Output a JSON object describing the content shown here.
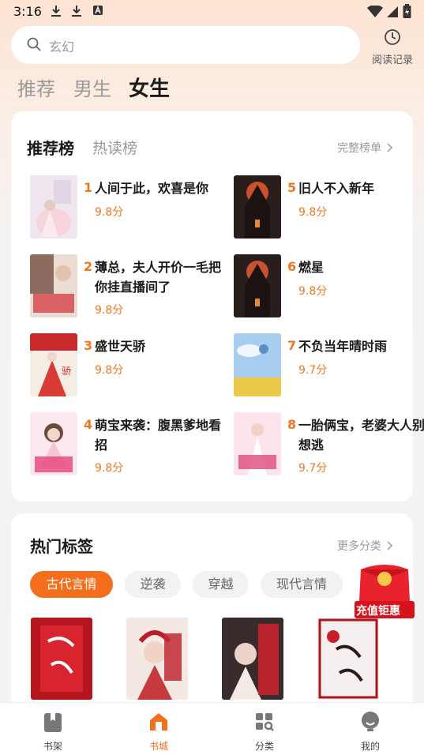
{
  "status_bar": {
    "time": "3:16"
  },
  "search": {
    "placeholder": "玄幻",
    "history_label": "阅读记录"
  },
  "top_tabs": [
    {
      "label": "推荐"
    },
    {
      "label": "男生"
    },
    {
      "label": "女生"
    }
  ],
  "ranking": {
    "tabs": [
      {
        "label": "推荐榜"
      },
      {
        "label": "热读榜"
      }
    ],
    "more_label": "完整榜单",
    "items": [
      {
        "rank": "1",
        "title": "人间于此，欢喜是你",
        "score": "9.8分"
      },
      {
        "rank": "2",
        "title": "薄总，夫人开价一毛把你挂直播间了",
        "score": "9.8分"
      },
      {
        "rank": "3",
        "title": "盛世天骄",
        "score": "9.8分"
      },
      {
        "rank": "4",
        "title": "萌宝来袭：腹黑爹地看招",
        "score": "9.8分"
      },
      {
        "rank": "5",
        "title": "旧人不入新年",
        "score": "9.8分"
      },
      {
        "rank": "6",
        "title": "燃星",
        "score": "9.8分"
      },
      {
        "rank": "7",
        "title": "不负当年晴时雨",
        "score": "9.7分"
      },
      {
        "rank": "8",
        "title": "一胎俩宝，老婆大人别想逃",
        "score": "9.7分"
      }
    ]
  },
  "hot_tags": {
    "title": "热门标签",
    "more_label": "更多分类",
    "chips": [
      {
        "label": "古代言情"
      },
      {
        "label": "逆袭"
      },
      {
        "label": "穿越"
      },
      {
        "label": "现代言情"
      }
    ]
  },
  "promo": {
    "label": "充值钜惠"
  },
  "bottom_nav": [
    {
      "label": "书架",
      "icon": "bookshelf-icon"
    },
    {
      "label": "书城",
      "icon": "store-icon"
    },
    {
      "label": "分类",
      "icon": "category-icon"
    },
    {
      "label": "我的",
      "icon": "profile-icon"
    }
  ],
  "colors": {
    "accent": "#f36f1d",
    "score": "#f2761f"
  }
}
